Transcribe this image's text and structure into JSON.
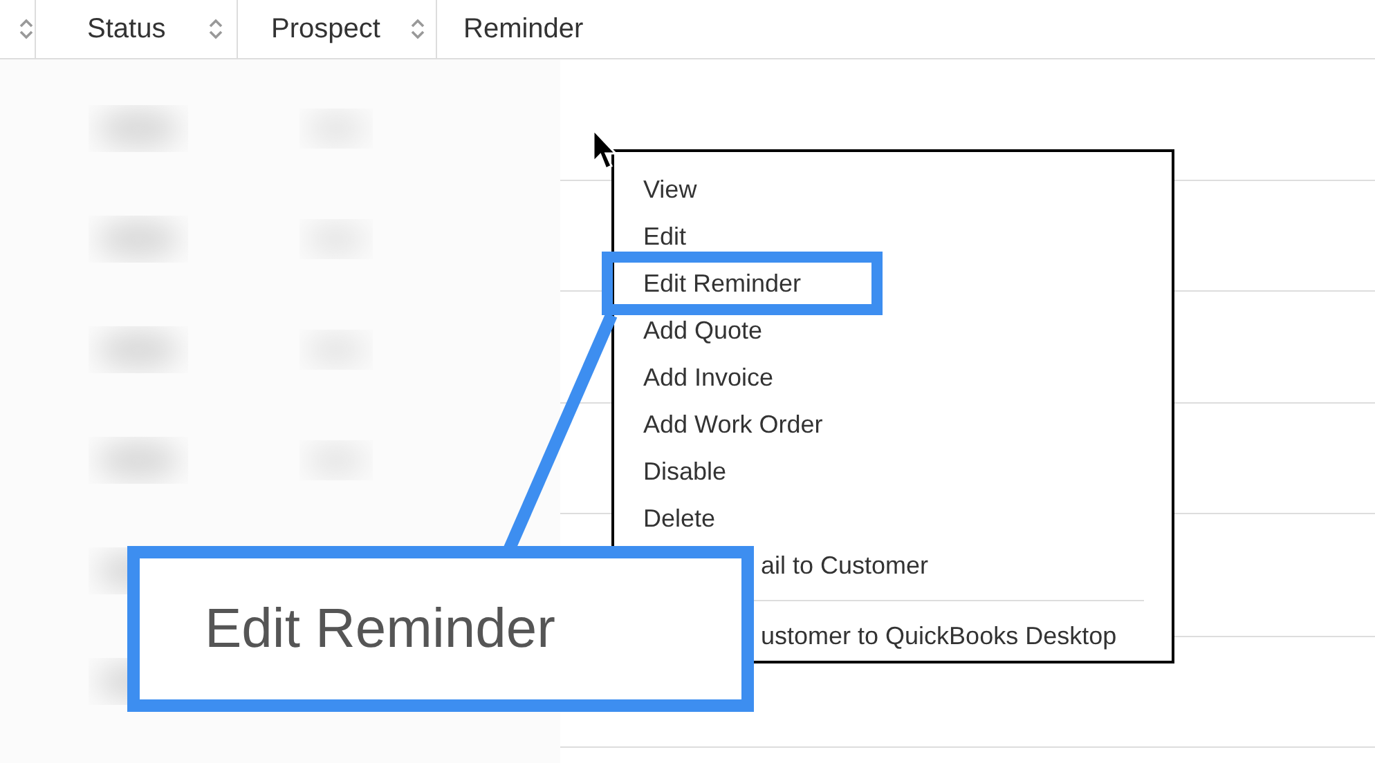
{
  "table": {
    "columns": [
      {
        "sortable": true
      },
      {
        "label": "Status",
        "sortable": true
      },
      {
        "label": "Prospect",
        "sortable": true
      },
      {
        "label": "Reminder",
        "sortable": false
      }
    ]
  },
  "context_menu": {
    "items": [
      {
        "kind": "item",
        "label": "View",
        "highlighted": false,
        "covered": false
      },
      {
        "kind": "item",
        "label": "Edit",
        "highlighted": false,
        "covered": false
      },
      {
        "kind": "item",
        "label": "Edit Reminder",
        "highlighted": true,
        "covered": false
      },
      {
        "kind": "item",
        "label": "Add Quote",
        "highlighted": false,
        "covered": false
      },
      {
        "kind": "item",
        "label": "Add Invoice",
        "highlighted": false,
        "covered": false
      },
      {
        "kind": "item",
        "label": "Add Work Order",
        "highlighted": false,
        "covered": false
      },
      {
        "kind": "item",
        "label": "Disable",
        "highlighted": false,
        "covered": false
      },
      {
        "kind": "item",
        "label": "Delete",
        "highlighted": false,
        "covered": false
      },
      {
        "kind": "item",
        "label": "ail to Customer",
        "highlighted": false,
        "covered": true
      },
      {
        "kind": "separator"
      },
      {
        "kind": "item",
        "label": "ustomer to QuickBooks Desktop",
        "highlighted": false,
        "covered": true
      }
    ]
  },
  "callout": {
    "text": "Edit Reminder"
  }
}
